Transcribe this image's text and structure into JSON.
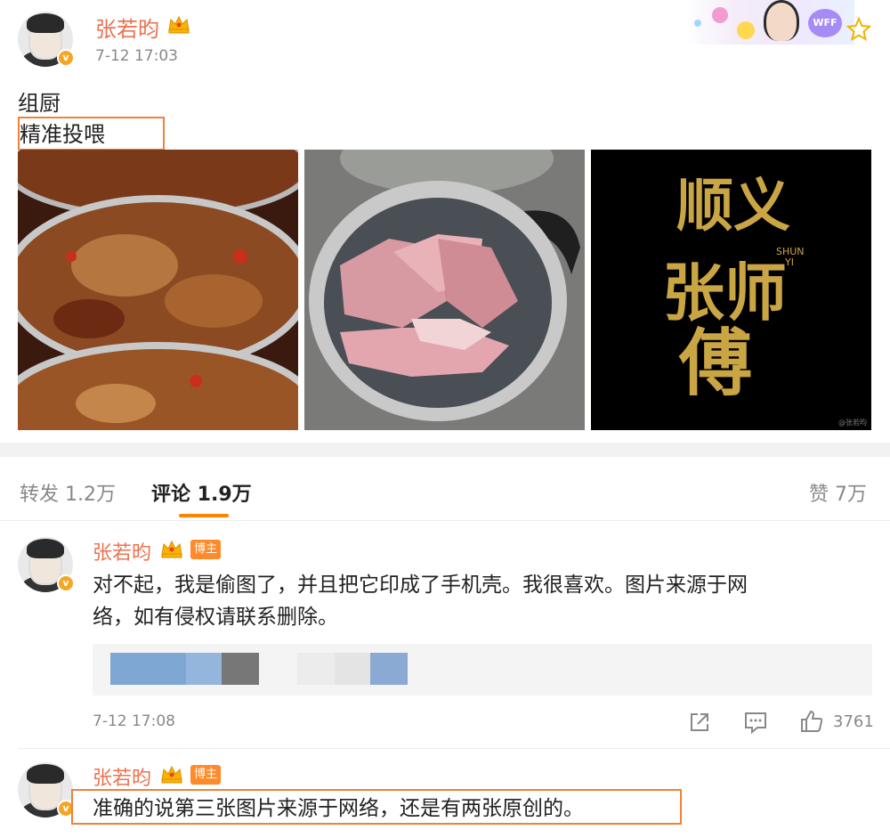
{
  "post": {
    "author": "张若昀",
    "timestamp": "7-12 17:03",
    "lines": [
      "组厨",
      "精准投喂"
    ],
    "images": [
      {
        "icon": "braised-meat-pot-photo"
      },
      {
        "icon": "raw-pork-pot-photo"
      },
      {
        "icon": "shun-yi-zhang-shifu-poster",
        "calligraphy": [
          "顺义",
          "张师",
          "傅"
        ],
        "subtitle_lines": [
          "SHUN",
          "YI"
        ],
        "watermark": "@张若昀"
      }
    ]
  },
  "tabs": {
    "repost": "转发 1.2万",
    "comments": "评论 1.9万",
    "likes": "赞 7万"
  },
  "comments": [
    {
      "author": "张若昀",
      "badge": "博主",
      "line1": "对不起，我是偷图了，并且把它印成了手机壳。我很喜欢。图片来源于网",
      "line2": "络，如有侵权请联系删除。",
      "time": "7-12 17:08",
      "likes": "3761"
    },
    {
      "author": "张若昀",
      "badge": "博主",
      "line1": "准确的说第三张图片来源于网络，还是有两张原创的。"
    }
  ],
  "colors": {
    "accent": "#ff8200",
    "username": "#eb7350",
    "highlight": "#f0813a"
  }
}
